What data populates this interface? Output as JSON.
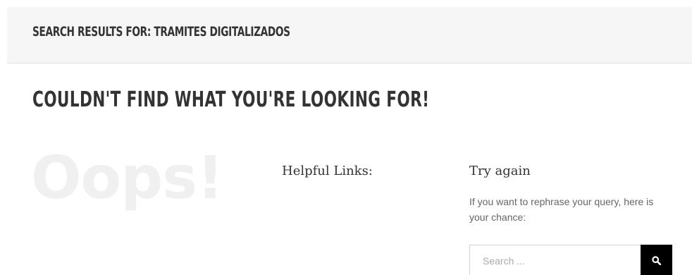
{
  "header": {
    "title": "Search results for: TRAMITES DIGITALIZADOS"
  },
  "main": {
    "heading": "Couldn't find what you're looking for!",
    "oops_text": "Oops!",
    "helpful_links": {
      "title": "Helpful Links:"
    },
    "try_again": {
      "title": "Try again",
      "description": "If you want to rephrase your query, here is your chance:",
      "search": {
        "placeholder": "Search ...",
        "value": "",
        "button_icon": "search-icon"
      }
    }
  },
  "colors": {
    "title_bar_background": "#f6f6f6",
    "heading_text": "#333333",
    "oops_text": "#f0f0f0",
    "body_text": "#666666",
    "search_button_background": "#000000",
    "search_icon": "#ffffff"
  }
}
